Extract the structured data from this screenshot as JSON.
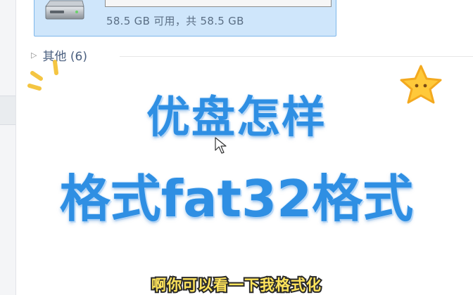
{
  "drive": {
    "capacity_text": "58.5 GB 可用，共 58.5 GB",
    "used_fraction": 0.0
  },
  "group": {
    "label": "其他 (6)"
  },
  "overlay": {
    "headline_line1": "优盘怎样",
    "headline_line2": "格式fat32格式",
    "subtitle": "啊你可以看一下我格式化"
  },
  "colors": {
    "headline": "#2f8fe3",
    "subtitle": "#ffe45c",
    "drive_tile": "#cfe6fb",
    "star": "#ffc93a"
  },
  "icons": [
    "usb-drive-icon",
    "mouse-cursor-icon",
    "sparkle-icon",
    "star-icon",
    "expand-arrow-icon"
  ]
}
